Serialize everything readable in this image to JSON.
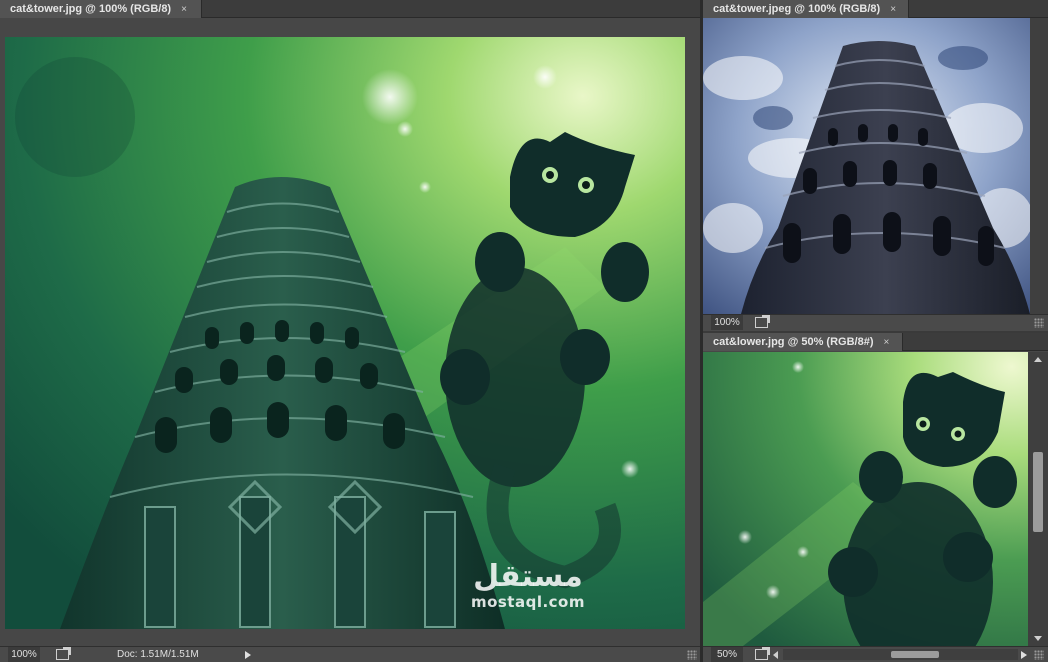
{
  "windows": {
    "main": {
      "tab_title": "cat&tower.jpg @ 100% (RGB/8)",
      "zoom": "100%",
      "doc_info": "Doc: 1.51M/1.51M"
    },
    "tower": {
      "tab_title": "cat&tower.jpeg @ 100% (RGB/8)",
      "zoom": "100%"
    },
    "cat": {
      "tab_title": "cat&lower.jpg @ 50% (RGB/8#)",
      "zoom": "50%"
    }
  },
  "tab_close_glyph": "×",
  "watermark": {
    "arabic": "مستقل",
    "latin": "mostaql.com"
  },
  "icons": [
    "close-icon",
    "share-icon",
    "arrow-right-icon",
    "resize-grip-icon",
    "scroll-up-icon",
    "scroll-down-icon",
    "scroll-left-icon",
    "scroll-right-icon"
  ],
  "colors": {
    "ui_dark": "#3a3a3a",
    "tab_active": "#535353",
    "image_green": "#2f8f45",
    "sky_blue": "#8ea3c9"
  }
}
